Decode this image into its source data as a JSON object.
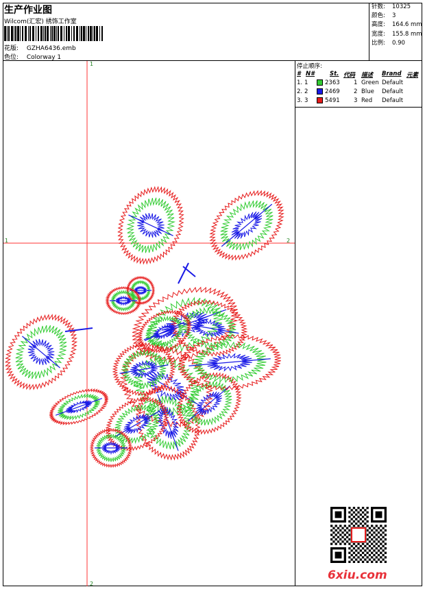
{
  "header": {
    "title": "生产作业图",
    "company": "Wilcom(汇宏) 绣饰工作室",
    "design_label": "花版:",
    "design_file": "GZHA6436.emb",
    "colorway_label": "色位:",
    "colorway": "Colorway 1"
  },
  "stats": [
    {
      "label": "针数:",
      "value": "10325"
    },
    {
      "label": "颜色:",
      "value": "3"
    },
    {
      "label": "高度:",
      "value": "164.6 mm"
    },
    {
      "label": "宽度:",
      "value": "155.8 mm"
    },
    {
      "label": "比例:",
      "value": "0.90"
    }
  ],
  "stop_sequence": {
    "title": "停止顺序:",
    "headers": {
      "num": "#",
      "n": "N#",
      "st": "St.",
      "code": "代码",
      "desc": "描述",
      "brand": "Brand",
      "element": "元素"
    },
    "rows": [
      {
        "num": "1.",
        "n": "1",
        "stitches": "2363",
        "code": "1",
        "desc": "Green",
        "brand": "Default",
        "color": "#33cc33"
      },
      {
        "num": "2.",
        "n": "2",
        "stitches": "2469",
        "code": "2",
        "desc": "Blue",
        "brand": "Default",
        "color": "#1a1ae6"
      },
      {
        "num": "3.",
        "n": "3",
        "stitches": "5491",
        "code": "3",
        "desc": "Red",
        "brand": "Default",
        "color": "#e61a1a"
      }
    ]
  },
  "guides": {
    "v_top": "1",
    "v_bottom": "2",
    "h_left": "1",
    "h_right": "2"
  },
  "watermark": "6xiu.com",
  "colors": {
    "green": "#33cc33",
    "blue": "#1a1ae6",
    "red": "#e61a1a",
    "guide": "#ff3333"
  }
}
